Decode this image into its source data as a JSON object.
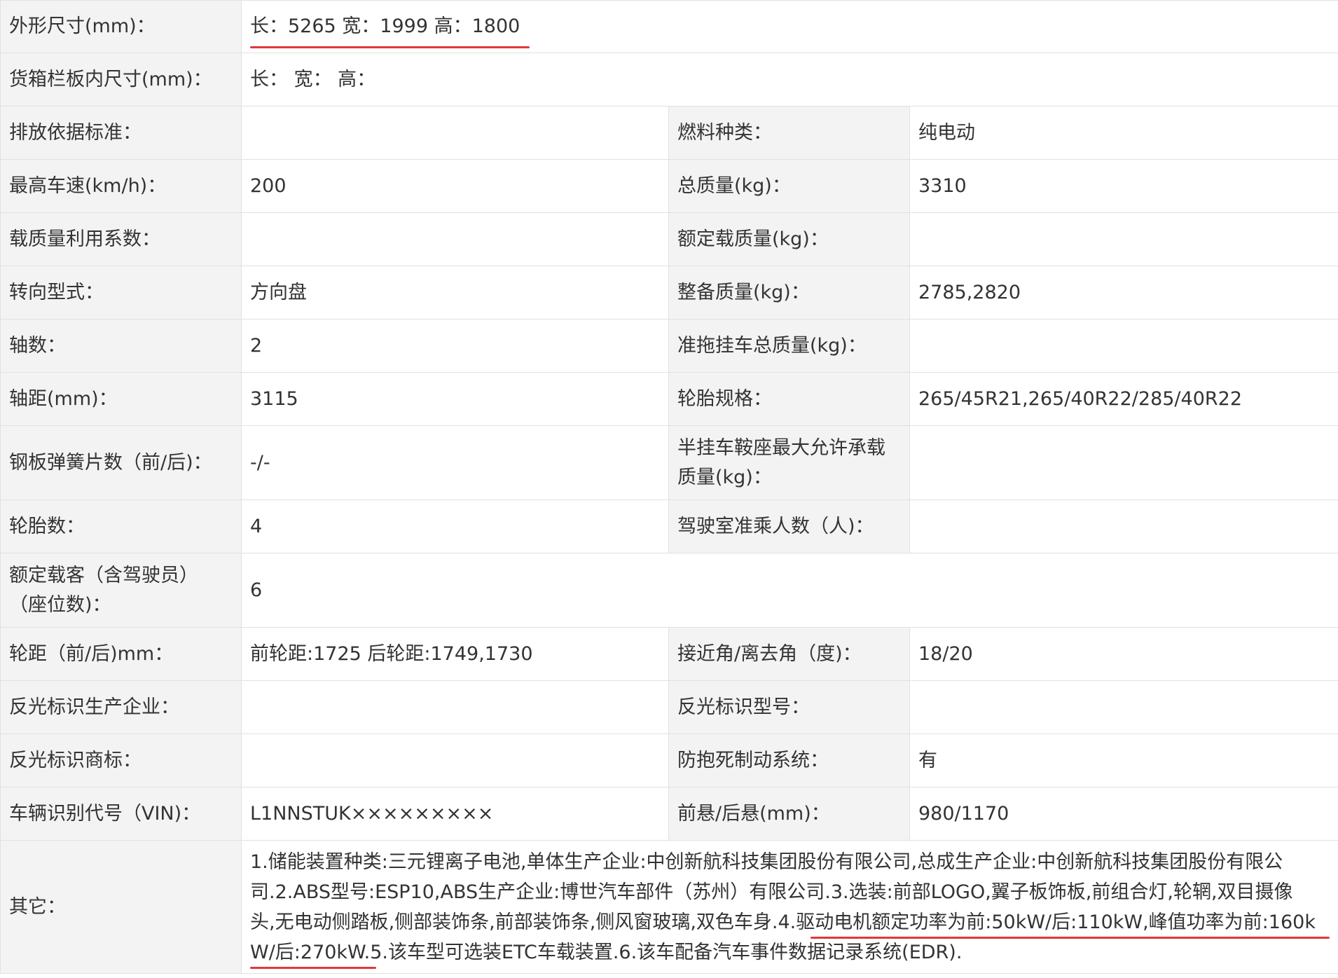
{
  "rows": {
    "dims": {
      "label": "外形尺寸(mm)：",
      "value": "长：5265 宽：1999 高：1800"
    },
    "cargo": {
      "label": "货箱栏板内尺寸(mm)：",
      "value": "长：  宽：  高："
    },
    "r3": {
      "l1": "排放依据标准：",
      "v1": "",
      "l2": "燃料种类：",
      "v2": "纯电动"
    },
    "r4": {
      "l1": "最高车速(km/h)：",
      "v1": "200",
      "l2": "总质量(kg)：",
      "v2": "3310"
    },
    "r5": {
      "l1": "载质量利用系数：",
      "v1": "",
      "l2": "额定载质量(kg)：",
      "v2": ""
    },
    "r6": {
      "l1": "转向型式：",
      "v1": "方向盘",
      "l2": "整备质量(kg)：",
      "v2": "2785,2820"
    },
    "r7": {
      "l1": "轴数：",
      "v1": "2",
      "l2": "准拖挂车总质量(kg)：",
      "v2": ""
    },
    "r8": {
      "l1": "轴距(mm)：",
      "v1": "3115",
      "l2": "轮胎规格：",
      "v2": "265/45R21,265/40R22/285/40R22"
    },
    "r9": {
      "l1": "钢板弹簧片数（前/后)：",
      "v1": "-/-",
      "l2_a": "半挂车鞍座最大允许承载",
      "l2_b": "质量(kg)：",
      "v2": ""
    },
    "r10": {
      "l1": "轮胎数：",
      "v1": "4",
      "l2": "驾驶室准乘人数（人)：",
      "v2": ""
    },
    "r11": {
      "l1_a": "额定载客（含驾驶员）",
      "l1_b": "（座位数)：",
      "v1": "6"
    },
    "r12": {
      "l1": "轮距（前/后)mm：",
      "v1": "前轮距:1725 后轮距:1749,1730",
      "l2": "接近角/离去角（度)：",
      "v2": "18/20"
    },
    "r13": {
      "l1": "反光标识生产企业：",
      "v1": "",
      "l2": "反光标识型号：",
      "v2": ""
    },
    "r14": {
      "l1": "反光标识商标：",
      "v1": "",
      "l2": "防抱死制动系统：",
      "v2": "有"
    },
    "r15": {
      "l1": "车辆识别代号（VIN)：",
      "v1": "L1NNSTUK×××××××××",
      "l2": "前悬/后悬(mm)：",
      "v2": "980/1170"
    },
    "other": {
      "label": "其它：",
      "line1": "1.储能装置种类:三元锂离子电池,单体生产企业:中创新航科技集团股份有限公司,总成生产企业:中创新航科技集团股份有限公",
      "line2": "司.2.ABS型号:ESP10,ABS生产企业:博世汽车部件（苏州）有限公司.3.选装:前部LOGO,翼子板饰板,前组合灯,轮辋,双目摄像",
      "line3": "头,无电动侧踏板,侧部装饰条,前部装饰条,侧风窗玻璃,双色车身.4.驱动电机额定功率为前:50kW/后:110kW,峰值功率为前:160k",
      "line4": "W/后:270kW.5.该车型可选装ETC车载装置.6.该车配备汽车事件数据记录系统(EDR)."
    }
  },
  "colors": {
    "label_bg": "#f3f3f3",
    "border": "#e1e1e1",
    "underline": "#e0393b"
  }
}
